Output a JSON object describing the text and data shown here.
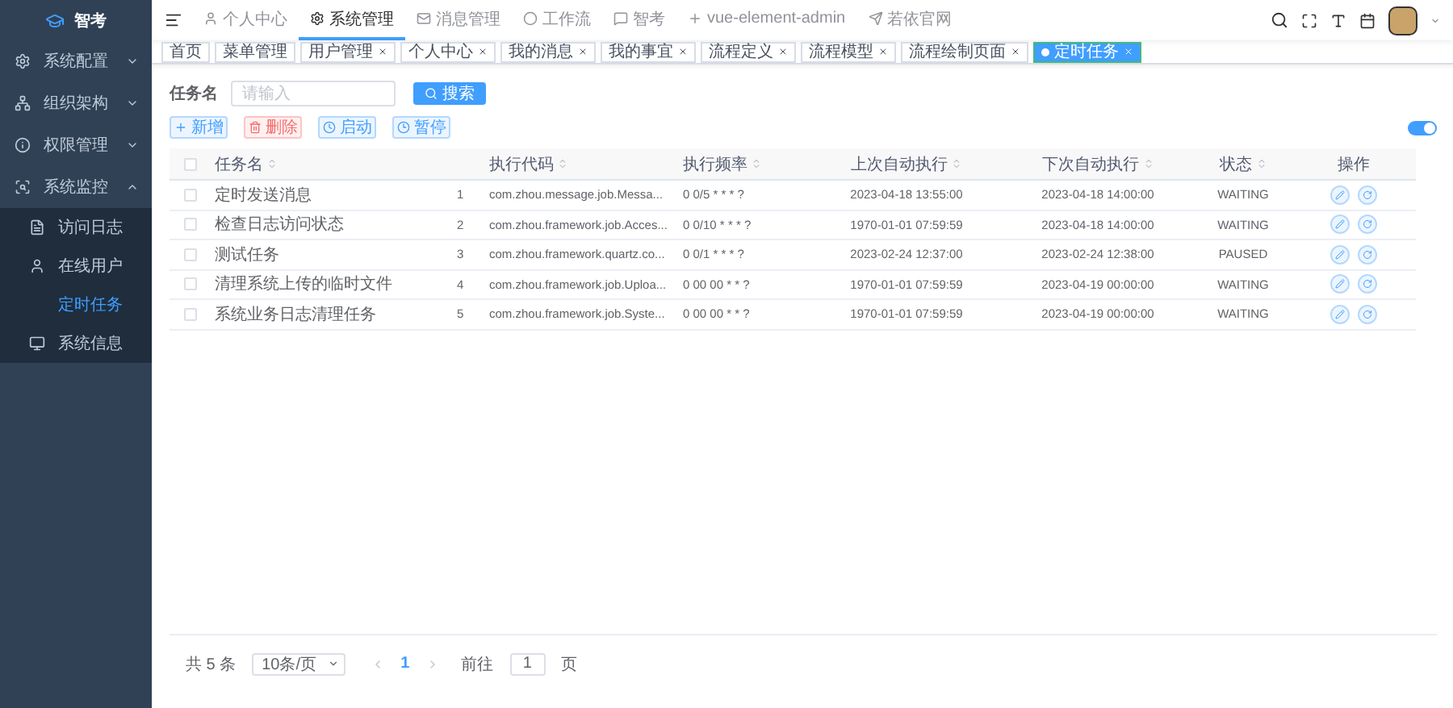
{
  "brand": {
    "name": "智考"
  },
  "sidebar": {
    "items": [
      {
        "label": "系统配置",
        "expanded": false
      },
      {
        "label": "组织架构",
        "expanded": false
      },
      {
        "label": "权限管理",
        "expanded": false
      },
      {
        "label": "系统监控",
        "expanded": true,
        "children": [
          {
            "label": "访问日志",
            "selected": false
          },
          {
            "label": "在线用户",
            "selected": false
          },
          {
            "label": "定时任务",
            "selected": true
          },
          {
            "label": "系统信息",
            "selected": false
          }
        ]
      }
    ]
  },
  "top_nav": {
    "items": [
      {
        "label": "个人中心",
        "selected": false
      },
      {
        "label": "系统管理",
        "selected": true
      },
      {
        "label": "消息管理",
        "selected": false
      },
      {
        "label": "工作流",
        "selected": false
      },
      {
        "label": "智考",
        "selected": false
      },
      {
        "label": "vue-element-admin",
        "selected": false
      },
      {
        "label": "若依官网",
        "selected": false
      }
    ]
  },
  "tags": [
    {
      "label": "首页",
      "closable": false,
      "selected": false
    },
    {
      "label": "菜单管理",
      "closable": false,
      "selected": false
    },
    {
      "label": "用户管理",
      "closable": true,
      "selected": false
    },
    {
      "label": "个人中心",
      "closable": true,
      "selected": false
    },
    {
      "label": "我的消息",
      "closable": true,
      "selected": false
    },
    {
      "label": "我的事宜",
      "closable": true,
      "selected": false
    },
    {
      "label": "流程定义",
      "closable": true,
      "selected": false
    },
    {
      "label": "流程模型",
      "closable": true,
      "selected": false
    },
    {
      "label": "流程绘制页面",
      "closable": true,
      "selected": false
    },
    {
      "label": "定时任务",
      "closable": true,
      "selected": true
    }
  ],
  "search": {
    "label": "任务名",
    "placeholder": "请输入",
    "button": "搜索"
  },
  "actions": [
    {
      "label": "新增",
      "kind": "add"
    },
    {
      "label": "删除",
      "kind": "delete"
    },
    {
      "label": "启动",
      "kind": "start"
    },
    {
      "label": "暂停",
      "kind": "pause"
    }
  ],
  "toggle": {
    "on": true
  },
  "table": {
    "select_all": {
      "checked": false
    },
    "columns": [
      "任务名",
      "执行代码",
      "执行频率",
      "上次自动执行",
      "下次自动执行",
      "状态",
      "操作"
    ],
    "rows": [
      {
        "checked": false,
        "name": "定时发送消息",
        "index": "1",
        "code": "com.zhou.message.job.Messa...",
        "cron": "0 0/5 * * * ?",
        "last": "2023-04-18 13:55:00",
        "next": "2023-04-18 14:00:00",
        "status": "WAITING"
      },
      {
        "checked": false,
        "name": "检查日志访问状态",
        "index": "2",
        "code": "com.zhou.framework.job.Acces...",
        "cron": "0 0/10 * * * ?",
        "last": "1970-01-01 07:59:59",
        "next": "2023-04-18 14:00:00",
        "status": "WAITING"
      },
      {
        "checked": false,
        "name": "测试任务",
        "index": "3",
        "code": "com.zhou.framework.quartz.co...",
        "cron": "0 0/1 * * * ?",
        "last": "2023-02-24 12:37:00",
        "next": "2023-02-24 12:38:00",
        "status": "PAUSED"
      },
      {
        "checked": false,
        "name": "清理系统上传的临时文件",
        "index": "4",
        "code": "com.zhou.framework.job.Uploa...",
        "cron": "0 00 00 * * ?",
        "last": "1970-01-01 07:59:59",
        "next": "2023-04-19 00:00:00",
        "status": "WAITING"
      },
      {
        "checked": false,
        "name": "系统业务日志清理任务",
        "index": "5",
        "code": "com.zhou.framework.job.Syste...",
        "cron": "0 00 00 * * ?",
        "last": "1970-01-01 07:59:59",
        "next": "2023-04-19 00:00:00",
        "status": "WAITING"
      }
    ]
  },
  "pagination": {
    "total": "共 5 条",
    "page_size": "10条/页",
    "pages": [
      {
        "label": "1",
        "selected": true
      }
    ],
    "goto_label": "前往",
    "goto_value": "1",
    "goto_suffix": "页"
  }
}
